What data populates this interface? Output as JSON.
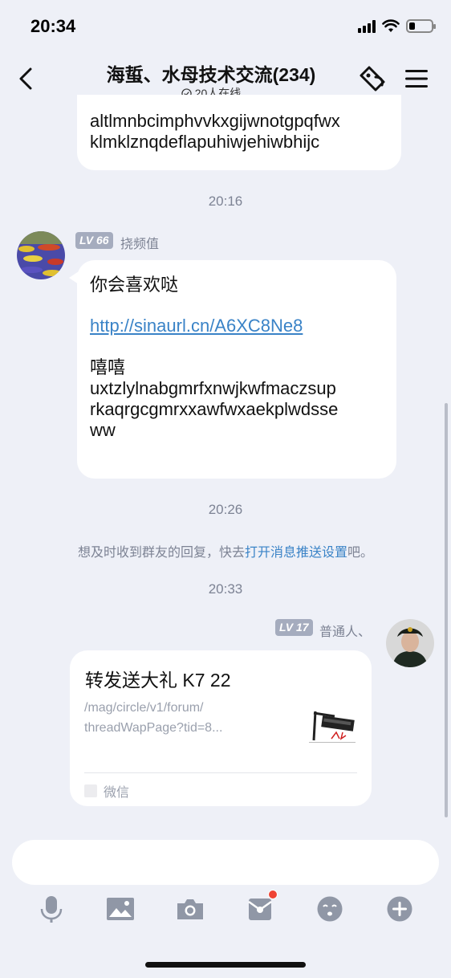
{
  "status": {
    "time": "20:34"
  },
  "nav": {
    "title": "海蜇、水母技术交流(234)",
    "online": "20人在线"
  },
  "messages": {
    "top_bubble": {
      "line1": "altlmnbcimphvvkxgijwnotgpqfwx",
      "line2": "klmklznqdeflapuhiwjehiwbhijc"
    },
    "time1": "20:16",
    "msg1": {
      "lv": "LV 66",
      "sender": "挠频值",
      "text1": "你会喜欢哒",
      "link": "http://sinaurl.cn/A6XC8Ne8",
      "text2": "嘻嘻",
      "text3": "uxtzlylnabgmrfxnwjkwfmaczsup",
      "text4": "rkaqrgcgmrxxawfwxaekplwdsse",
      "text5": "ww"
    },
    "time2": "20:26",
    "tip": {
      "prefix": "想及时收到群友的回复，快去",
      "link": "打开消息推送设置",
      "suffix": "吧。"
    },
    "time3": "20:33",
    "msg2": {
      "lv": "LV 17",
      "sender": "普通人、",
      "card_title": "转发送大礼 K7 22",
      "card_desc1": "/mag/circle/v1/forum/",
      "card_desc2": "threadWapPage?tid=8...",
      "card_source": "微信"
    }
  },
  "toolbar": {
    "icons": [
      "microphone-icon",
      "image-icon",
      "camera-icon",
      "red-packet-icon",
      "emoji-icon",
      "plus-icon"
    ]
  },
  "colors": {
    "background": "#eef0f7",
    "link": "#3a83c7",
    "badge": "#a5acbe",
    "notify_dot": "#ef4434"
  }
}
